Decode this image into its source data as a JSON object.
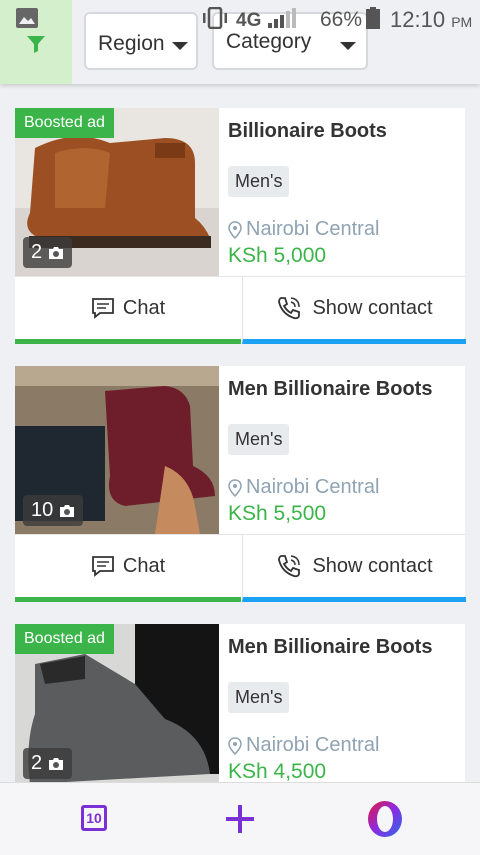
{
  "status_bar": {
    "network": "4G",
    "battery": "66%",
    "time": "12:10",
    "ampm": "PM",
    "icons": [
      "gallery-icon",
      "vibrate-icon",
      "signal-icon",
      "battery-icon"
    ]
  },
  "filters": {
    "filter_icon": "filter-icon",
    "region_label": "Region",
    "category_label": "Category"
  },
  "listings": [
    {
      "badge": "Boosted ad",
      "photo_count": "2",
      "title": "Billionaire Boots",
      "tag": "Men's",
      "location": "Nairobi Central",
      "price": "KSh 5,000",
      "chat_label": "Chat",
      "contact_label": "Show contact"
    },
    {
      "badge": "",
      "photo_count": "10",
      "title": "Men Billionaire Boots",
      "tag": "Men's",
      "location": "Nairobi Central",
      "price": "KSh 5,500",
      "chat_label": "Chat",
      "contact_label": "Show contact"
    },
    {
      "badge": "Boosted ad",
      "photo_count": "2",
      "title": "Men Billionaire Boots",
      "tag": "Men's",
      "location": "Nairobi Central",
      "price": "KSh 4,500",
      "chat_label": "Chat",
      "contact_label": "Show contact"
    }
  ],
  "bottom_nav": {
    "tabs_count": "10",
    "icons": [
      "tabs-icon",
      "plus-icon",
      "opera-icon"
    ]
  },
  "colors": {
    "green": "#3bb54a",
    "blue": "#1da1f2",
    "purple": "#7b2fd6",
    "location_gray": "#8fa3b3"
  }
}
